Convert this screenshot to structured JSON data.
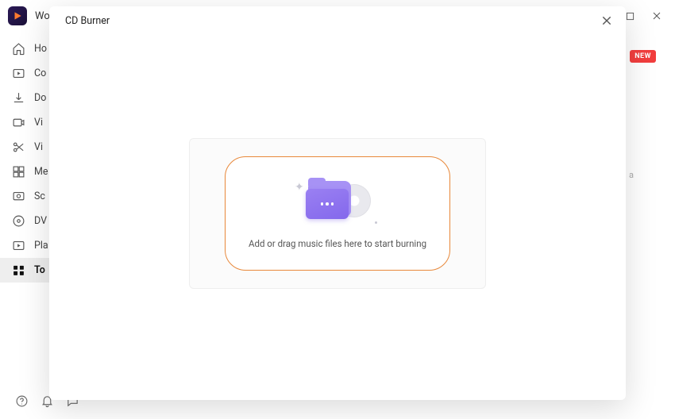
{
  "app": {
    "title": "Wo"
  },
  "window_controls": {},
  "sidebar": {
    "items": [
      {
        "id": "home",
        "label": "Ho"
      },
      {
        "id": "converter",
        "label": "Co"
      },
      {
        "id": "downloader",
        "label": "Do"
      },
      {
        "id": "video",
        "label": "Vi"
      },
      {
        "id": "video-edit",
        "label": "Vi"
      },
      {
        "id": "merger",
        "label": "Me"
      },
      {
        "id": "screen",
        "label": "Sc"
      },
      {
        "id": "dvd",
        "label": "DV"
      },
      {
        "id": "player",
        "label": "Pla"
      },
      {
        "id": "toolbox",
        "label": "To"
      }
    ]
  },
  "background": {
    "new_badge": "NEW",
    "faded_text": "a"
  },
  "modal": {
    "title": "CD Burner",
    "drop_text": "Add or drag music files here to start burning"
  }
}
